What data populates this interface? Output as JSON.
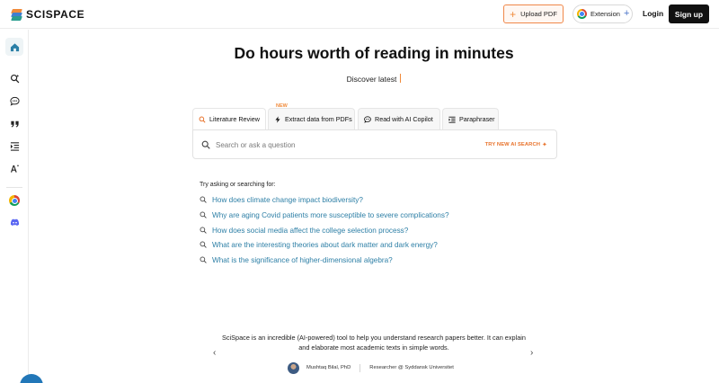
{
  "brand": {
    "name": "SCISPACE"
  },
  "header": {
    "upload_label": "Upload PDF",
    "extension_label": "Extension",
    "login_label": "Login",
    "signup_label": "Sign up"
  },
  "sidebar": {
    "items": [
      {
        "icon": "home-icon"
      },
      {
        "icon": "search-sparkle-icon"
      },
      {
        "icon": "chat-bubble-icon"
      },
      {
        "icon": "quote-icon"
      },
      {
        "icon": "list-indent-icon"
      },
      {
        "icon": "text-ai-icon"
      },
      {
        "icon": "chrome-icon"
      },
      {
        "icon": "discord-icon"
      }
    ]
  },
  "hero": {
    "title": "Do hours worth of reading in minutes",
    "subtitle": "Discover latest"
  },
  "tabs": [
    {
      "label": "Literature Review",
      "active": true
    },
    {
      "label": "Extract data from PDFs",
      "badge": "NEW"
    },
    {
      "label": "Read with AI Copilot"
    },
    {
      "label": "Paraphraser"
    }
  ],
  "search": {
    "placeholder": "Search or ask a question",
    "ai_label": "TRY NEW AI SEARCH"
  },
  "suggestions": {
    "heading": "Try asking or searching for:",
    "items": [
      "How does climate change impact biodiversity?",
      "Why are aging Covid patients more susceptible to severe complications?",
      "How does social media affect the college selection process?",
      "What are the interesting theories about dark matter and dark energy?",
      "What is the significance of higher-dimensional algebra?"
    ]
  },
  "testimonial": {
    "quote": "SciSpace is an incredible (AI-powered) tool to help you understand research papers better. It can explain and elaborate most academic texts in simple words.",
    "author": "Mushtaq Bilal, PhD",
    "role": "Researcher @ Syddansk Universitet"
  },
  "colors": {
    "accent": "#f08a3a",
    "link": "#2d7fa6",
    "primary_button": "#111111"
  }
}
